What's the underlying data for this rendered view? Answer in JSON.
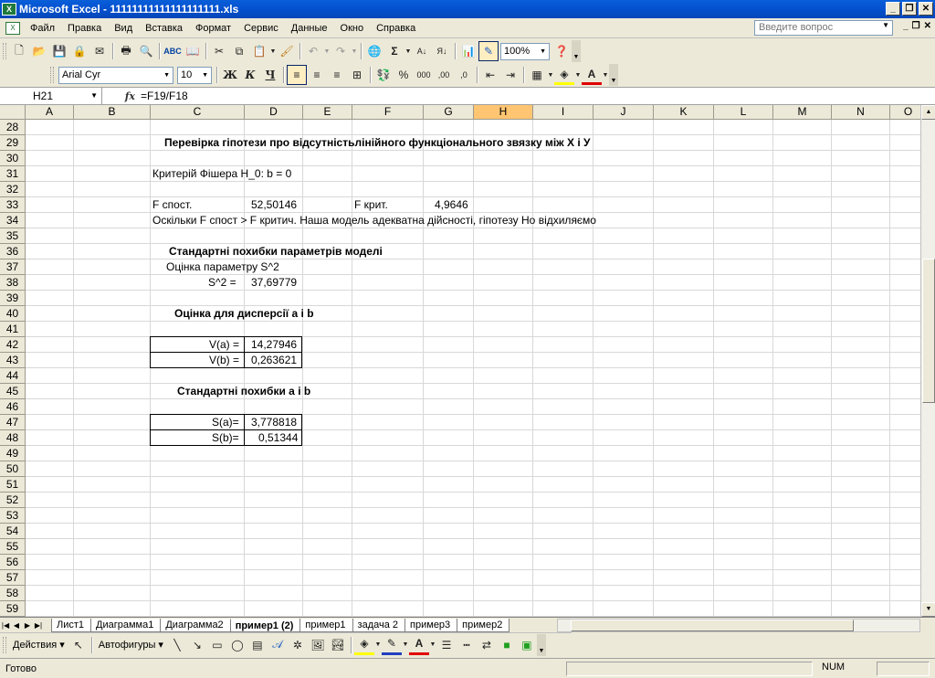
{
  "window": {
    "title": "Microsoft Excel - 11111111111111111111.xls",
    "app_icon": "X",
    "buttons": [
      "_",
      "❐",
      "✕"
    ]
  },
  "menu": {
    "items": [
      "Файл",
      "Правка",
      "Вид",
      "Вставка",
      "Формат",
      "Сервис",
      "Данные",
      "Окно",
      "Справка"
    ],
    "help_placeholder": "Введите вопрос",
    "right_buttons": [
      "_",
      "❐",
      "✕"
    ]
  },
  "toolbar": {
    "zoom": "100%",
    "font_name": "Arial Cyr",
    "font_size": "10",
    "bold": "Ж",
    "italic": "К",
    "underline": "Ч",
    "percent": "%",
    "thousands": "000",
    "dec_inc": ",00",
    "dec_dec": ",0",
    "sigma": "Σ"
  },
  "formula_bar": {
    "name_box": "H21",
    "fx": "fx",
    "formula": "=F19/F18"
  },
  "columns": [
    "A",
    "B",
    "C",
    "D",
    "E",
    "F",
    "G",
    "H",
    "I",
    "J",
    "K",
    "L",
    "M",
    "N",
    "O"
  ],
  "selected_column": "H",
  "row_numbers": [
    "28",
    "29",
    "30",
    "31",
    "32",
    "33",
    "34",
    "35",
    "36",
    "37",
    "38",
    "39",
    "40",
    "41",
    "42",
    "43",
    "44",
    "45",
    "46",
    "47",
    "48",
    "49",
    "50",
    "51",
    "52",
    "53",
    "54",
    "55",
    "56",
    "57",
    "58",
    "59"
  ],
  "cells": {
    "r29_title": "Перевірка гіпотези про відсутністьлінійного функціонального звязку між Х і У",
    "r31_c": "Критерій Фішера H_0: b = 0",
    "r33_c": "F спост.",
    "r33_d": "52,50146",
    "r33_f": "F крит.",
    "r33_g": "4,9646",
    "r34_c": "Оскільки F спост > F критич. Наша модель адекватна дійсності, гіпотезу Но відхиляємо",
    "r36_title": "Стандартні похибки параметрів моделі",
    "r37_c": "Оцінка параметру S^2",
    "r38_c": "S^2 =",
    "r38_d": "37,69779",
    "r40_title": "Оцінка для дисперсії а і b",
    "r42_c": "V(a) =",
    "r42_d": "14,27946",
    "r43_c": "V(b) =",
    "r43_d": "0,263621",
    "r45_title": "Стандартні похибки а і b",
    "r47_c": "S(a)=",
    "r47_d": "3,778818",
    "r48_c": "S(b)=",
    "r48_d": "0,51344"
  },
  "sheet_tabs": [
    "Лист1",
    "Диаграмма1",
    "Диаграмма2",
    "пример1 (2)",
    "пример1",
    "задача 2",
    "пример3",
    "пример2"
  ],
  "active_tab": "пример1 (2)",
  "drawing": {
    "actions": "Действия",
    "autoshapes": "Автофигуры"
  },
  "status": {
    "text": "Готово",
    "num": "NUM"
  }
}
